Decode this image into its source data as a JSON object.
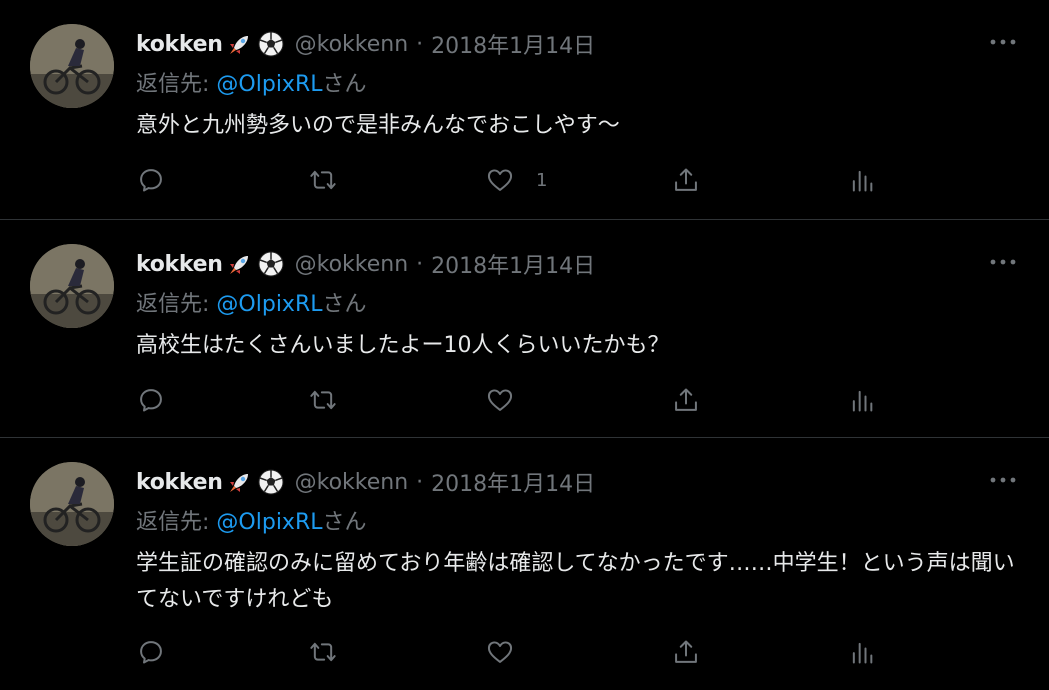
{
  "tweets": [
    {
      "name": "kokken",
      "emojis": [
        "rocket-emoji",
        "soccer-ball-emoji"
      ],
      "handle": "@kokkenn",
      "separator": "·",
      "date": "2018年1月14日",
      "reply_prefix": "返信先:",
      "reply_to": "@OlpixRL",
      "reply_suffix": "さん",
      "text": "意外と九州勢多いので是非みんなでおこしやす～",
      "like_count": "1"
    },
    {
      "name": "kokken",
      "emojis": [
        "rocket-emoji",
        "soccer-ball-emoji"
      ],
      "handle": "@kokkenn",
      "separator": "·",
      "date": "2018年1月14日",
      "reply_prefix": "返信先:",
      "reply_to": "@OlpixRL",
      "reply_suffix": "さん",
      "text": "高校生はたくさんいましたよー10人くらいいたかも？",
      "like_count": ""
    },
    {
      "name": "kokken",
      "emojis": [
        "rocket-emoji",
        "soccer-ball-emoji"
      ],
      "handle": "@kokkenn",
      "separator": "·",
      "date": "2018年1月14日",
      "reply_prefix": "返信先:",
      "reply_to": "@OlpixRL",
      "reply_suffix": "さん",
      "text": "学生証の確認のみに留めており年齢は確認してなかったです……中学生！という声は聞いてないですけれども",
      "like_count": ""
    }
  ],
  "icons": {
    "more": "more-horizontal-icon",
    "reply": "reply-icon",
    "retweet": "retweet-icon",
    "like": "heart-icon",
    "share": "share-icon",
    "analytics": "analytics-icon"
  },
  "colors": {
    "background": "#000000",
    "text": "#e7e9ea",
    "secondary": "#71767b",
    "link": "#1d9bf0",
    "divider": "#2f3336"
  }
}
